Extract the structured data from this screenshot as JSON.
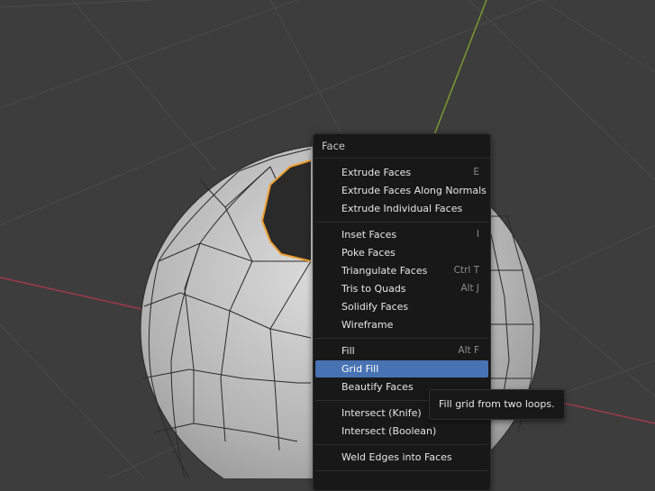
{
  "menu": {
    "title": "Face",
    "items": [
      {
        "label": "Extrude Faces",
        "shortcut": "E"
      },
      {
        "label": "Extrude Faces Along Normals",
        "shortcut": ""
      },
      {
        "label": "Extrude Individual Faces",
        "shortcut": ""
      },
      {
        "label": "Inset Faces",
        "shortcut": "I"
      },
      {
        "label": "Poke Faces",
        "shortcut": ""
      },
      {
        "label": "Triangulate Faces",
        "shortcut": "Ctrl T"
      },
      {
        "label": "Tris to Quads",
        "shortcut": "Alt J"
      },
      {
        "label": "Solidify Faces",
        "shortcut": ""
      },
      {
        "label": "Wireframe",
        "shortcut": ""
      },
      {
        "label": "Fill",
        "shortcut": "Alt F"
      },
      {
        "label": "Grid Fill",
        "shortcut": "",
        "active": true
      },
      {
        "label": "Beautify Faces",
        "shortcut": ""
      },
      {
        "label": "Intersect (Knife)",
        "shortcut": ""
      },
      {
        "label": "Intersect (Boolean)",
        "shortcut": ""
      },
      {
        "label": "Weld Edges into Faces",
        "shortcut": ""
      }
    ]
  },
  "tooltip": {
    "text": "Fill grid from two loops."
  },
  "colors": {
    "viewport_bg": "#3d3d3d",
    "grid_line": "#4a4a4a",
    "x_axis": "#9e3a48",
    "y_axis": "#7a9a30",
    "mesh_face": "#b8b8b8",
    "selection": "#f0a030",
    "menu_bg": "#181818",
    "highlight": "#4772b3"
  }
}
